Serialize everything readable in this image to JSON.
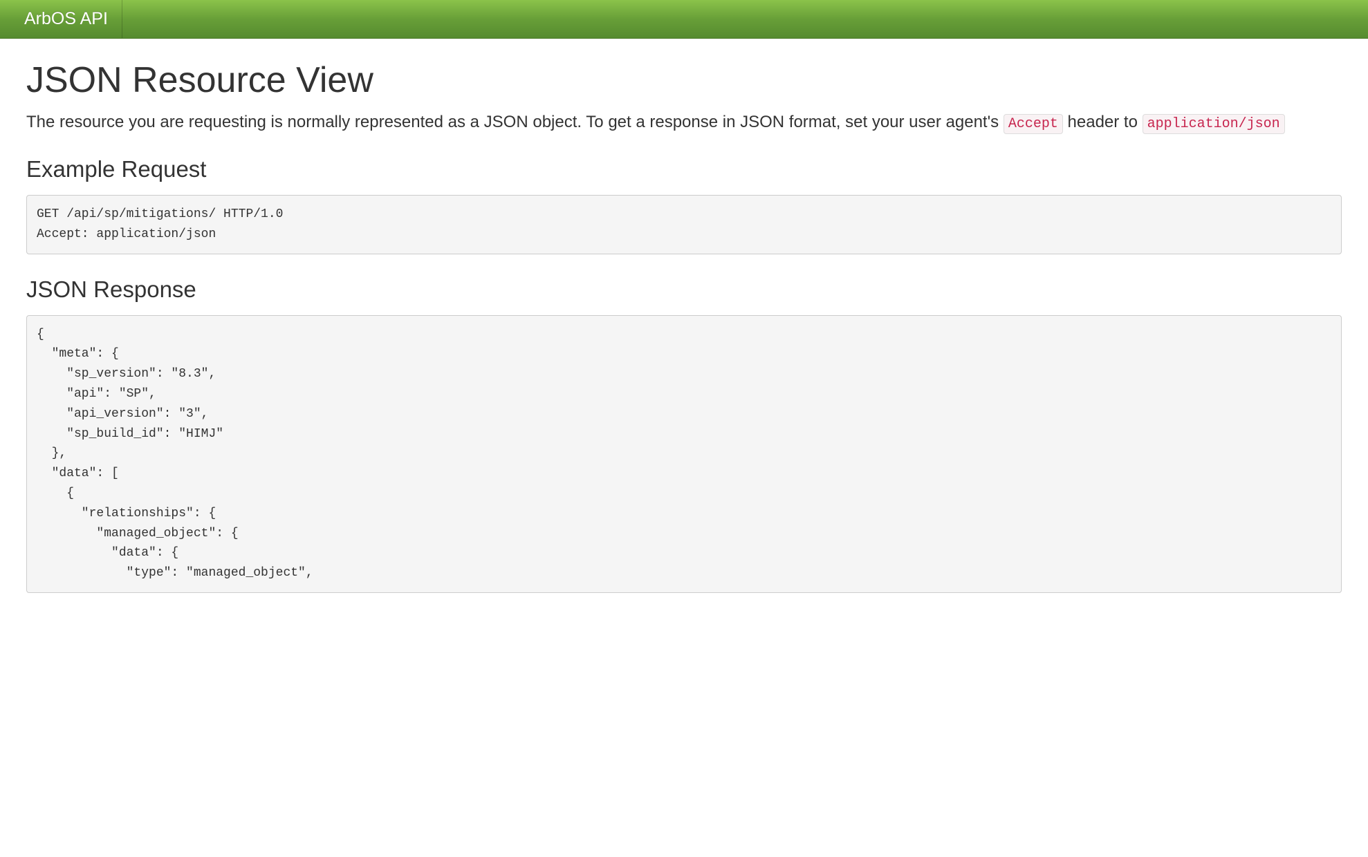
{
  "navbar": {
    "brand": "ArbOS API"
  },
  "page": {
    "title": "JSON Resource View",
    "lead_part1": "The resource you are requesting is normally represented as a JSON object. To get a response in JSON format, set your user agent's ",
    "code_accept": "Accept",
    "lead_part2": " header to ",
    "code_mime": "application/json"
  },
  "sections": {
    "example_request": {
      "heading": "Example Request",
      "code": "GET /api/sp/mitigations/ HTTP/1.0\nAccept: application/json"
    },
    "json_response": {
      "heading": "JSON Response",
      "code": "{\n  \"meta\": {\n    \"sp_version\": \"8.3\",\n    \"api\": \"SP\",\n    \"api_version\": \"3\",\n    \"sp_build_id\": \"HIMJ\"\n  },\n  \"data\": [\n    {\n      \"relationships\": {\n        \"managed_object\": {\n          \"data\": {\n            \"type\": \"managed_object\","
    }
  }
}
